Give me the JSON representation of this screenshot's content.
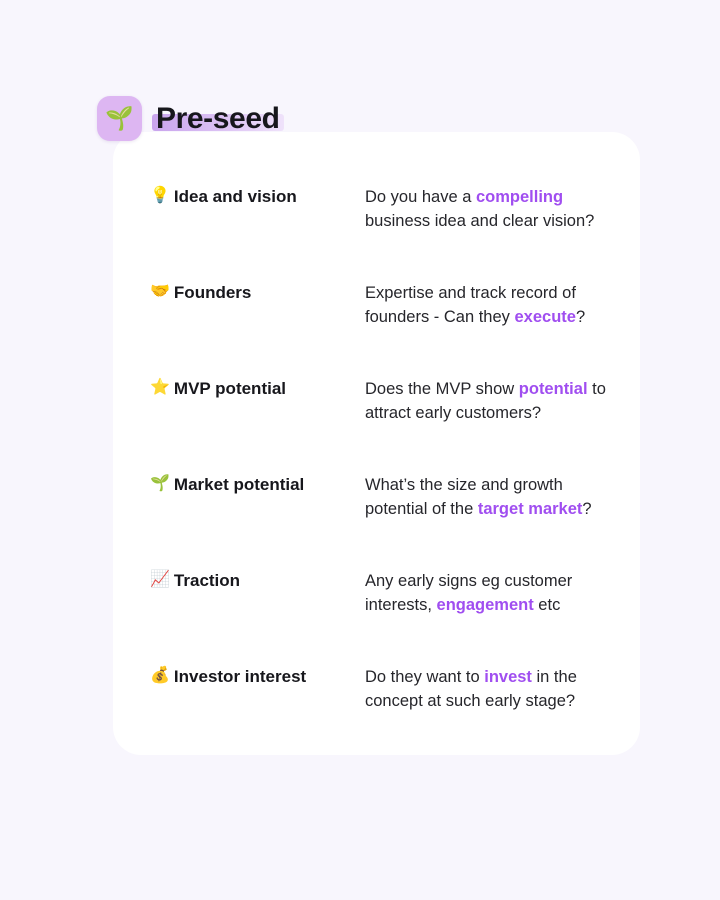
{
  "header": {
    "icon": "seedling-emoji",
    "icon_glyph": "🌱",
    "title": "Pre-seed",
    "highlight_color_start": "#c9a4ed",
    "highlight_color_end": "#efe2fa",
    "tile_color": "#ddb6f2"
  },
  "theme": {
    "page_background": "#f8f6fd",
    "card_background": "#ffffff",
    "accent": "#a04ef0",
    "text": "#17171c"
  },
  "rows": [
    {
      "emoji": "💡",
      "emoji_name": "light-bulb-emoji",
      "label": "Idea and vision",
      "desc_prefix": "Do you have a ",
      "desc_accent": "compelling",
      "desc_suffix": " business idea and clear vision?"
    },
    {
      "emoji": "🤝",
      "emoji_name": "handshake-emoji",
      "label": "Founders",
      "desc_prefix": "Expertise and track record of founders - Can they ",
      "desc_accent": "execute",
      "desc_suffix": "?"
    },
    {
      "emoji": "⭐",
      "emoji_name": "star-emoji",
      "label": "MVP potential",
      "desc_prefix": "Does the MVP show ",
      "desc_accent": "potential",
      "desc_suffix": " to attract early customers?"
    },
    {
      "emoji": "🌱",
      "emoji_name": "seedling-emoji",
      "label": "Market potential",
      "desc_prefix": "What’s the size and growth potential of the ",
      "desc_accent": "target market",
      "desc_suffix": "?"
    },
    {
      "emoji": "📈",
      "emoji_name": "chart-increasing-emoji",
      "label": "Traction",
      "desc_prefix": "Any early signs eg customer interests, ",
      "desc_accent": "engagement",
      "desc_suffix": " etc"
    },
    {
      "emoji": "💰",
      "emoji_name": "money-bag-emoji",
      "label": "Investor interest",
      "desc_prefix": "Do they want to ",
      "desc_accent": "invest",
      "desc_suffix": " in the concept at such early stage?"
    }
  ]
}
